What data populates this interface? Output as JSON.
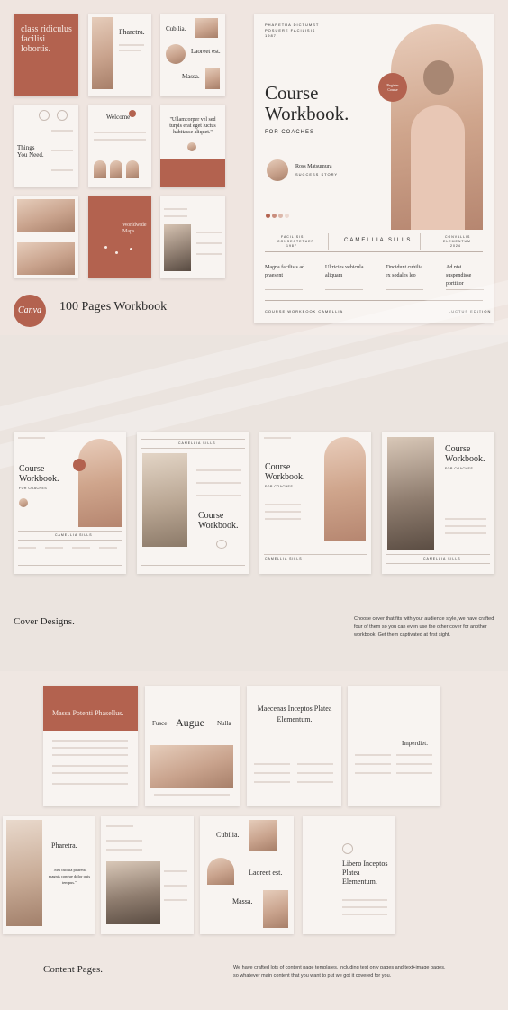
{
  "top": {
    "thumb_title": "class ridiculus facilisi lobortis.",
    "thumb_pharetra": "Pharetra.",
    "thumb_cubilia": "Cubilia.",
    "thumb_laoreet": "Laoreet est.",
    "thumb_massa": "Massa.",
    "thumb_things": "Things You Need.",
    "thumb_welcome": "Welcome",
    "thumb_quote": "\"Ullamcorper vel sed turpis erat eget luctus habitasse aliquet.\"",
    "thumb_worldwide": "Worldwide Maps.",
    "canva_label": "Canva",
    "pages_label": "100 Pages Workbook"
  },
  "cover": {
    "top_meta_1": "PHARETRA DICTUMST",
    "top_meta_2": "POSUERE FACILISIS",
    "top_meta_3": "1987",
    "title_line1": "Course",
    "title_line2": "Workbook.",
    "subtitle": "FOR COACHES",
    "badge_1": "Register",
    "badge_2": "Course",
    "author": "Ross Matsumura",
    "author_role": "SUCCESS STORY",
    "band_left_1": "FACILISIS",
    "band_left_2": "CONSECTETUER",
    "band_left_3": "1987",
    "band_center": "CAMELLIA SILLS",
    "band_right_1": "CONVALLIS",
    "band_right_2": "ELEMENTUM",
    "band_right_3": "2024",
    "col1": "Magna facilisis ad praesent",
    "col2": "Ultricies vehicula aliquam",
    "col3": "Tincidunt cubilia ex sodales leo",
    "col4": "Ad nisi suspendisse porttitor",
    "footer_left": "COURSE WORKBOOK CAMELLIA",
    "footer_right": "LUCTUS EDITION"
  },
  "covers": {
    "c1_title1": "Course",
    "c1_title2": "Workbook.",
    "c1_sub": "FOR COACHES",
    "c1_band": "CAMELLIA SILLS",
    "c2_band": "CAMELLIA SILLS",
    "c2_title1": "Course",
    "c2_title2": "Workbook.",
    "c3_title1": "Course",
    "c3_title2": "Workbook.",
    "c3_sub": "FOR COACHES",
    "c3_band": "CAMELLIA SILLS",
    "c4_title1": "Course",
    "c4_title2": "Workbook.",
    "c4_sub": "FOR COACHES",
    "c4_band": "CAMELLIA SILLS",
    "heading": "Cover Designs.",
    "description": "Choose cover that fits with your audience style, we have crafted four of them so you can even use the other cover for another workbook. Get them captivated at first sight."
  },
  "content": {
    "p1_title": "Massa Potenti Phasellus.",
    "p2_fusce": "Fusce",
    "p2_augue": "Augue",
    "p2_nulla": "Nulla",
    "p3_title": "Maecenas Inceptos Platea Elementum.",
    "p4_title": "Imperdiet.",
    "p5_title": "Pharetra.",
    "p5_quote": "\"Nisl cubilia pharetra magnis congue dolor quis tempus.\"",
    "p7_cubilia": "Cubilia.",
    "p7_laoreet": "Laoreet est.",
    "p7_massa": "Massa.",
    "p8_title": "Libero Inceptos Platea Elementum.",
    "heading": "Content Pages.",
    "description": "We have crafted lots of content page templates, including text only pages and text+image pages, so whatever main content that you want to put we got it covered for you."
  },
  "colors": {
    "accent": "#b3624f",
    "background": "#efe6e1",
    "page": "#f8f4f1"
  }
}
